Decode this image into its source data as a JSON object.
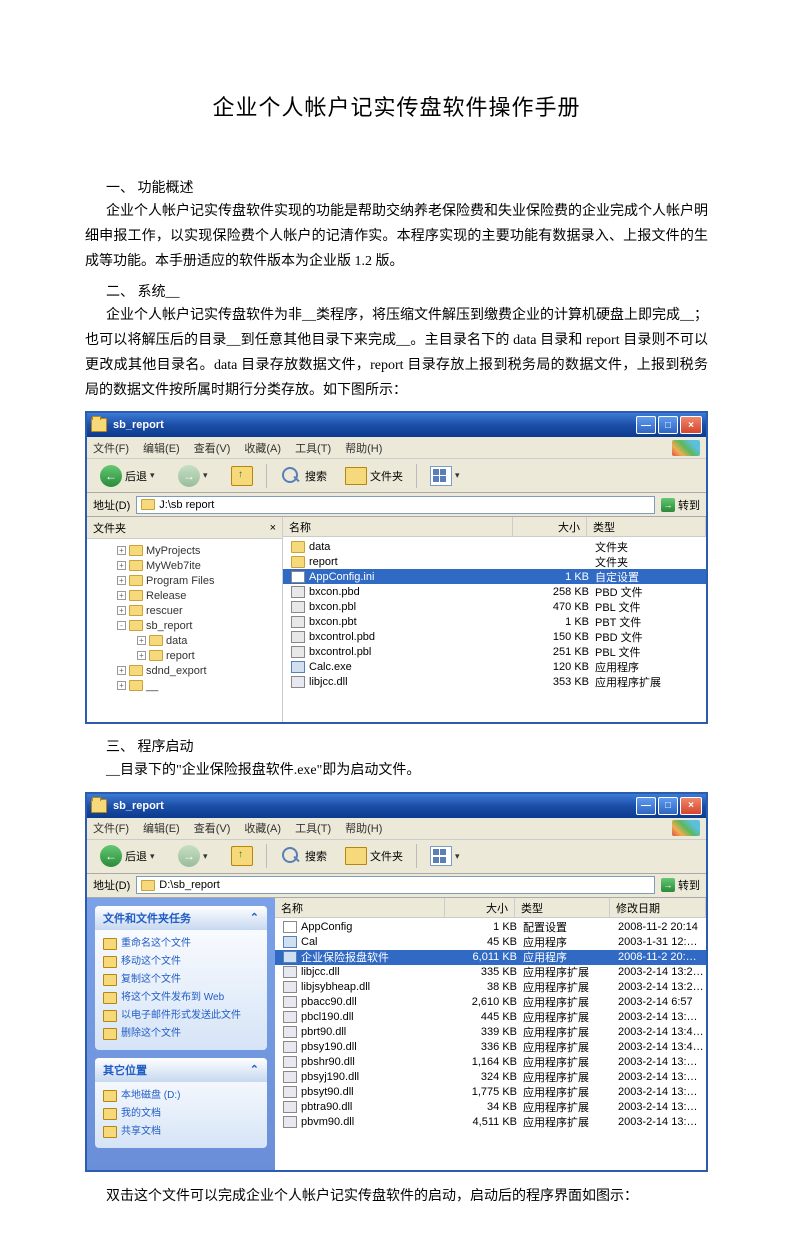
{
  "title": "企业个人帐户记实传盘软件操作手册",
  "s1": {
    "h": "一、 功能概述",
    "p": "企业个人帐户记实传盘软件实现的功能是帮助交纳养老保险费和失业保险费的企业完成个人帐户明细申报工作，以实现保险费个人帐户的记清作实。本程序实现的主要功能有数据录入、上报文件的生成等功能。本手册适应的软件版本为企业版 1.2 版。"
  },
  "s2": {
    "h": "二、 系统__",
    "p": "企业个人帐户记实传盘软件为非__类程序，将压缩文件解压到缴费企业的计算机硬盘上即完成__；也可以将解压后的目录__到任意其他目录下来完成__。主目录名下的 data 目录和 report 目录则不可以更改成其他目录名。data 目录存放数据文件，report 目录存放上报到税务局的数据文件，上报到税务局的数据文件按所属时期行分类存放。如下图所示："
  },
  "s3": {
    "h": "三、 程序启动",
    "p": "__目录下的\"企业保险报盘软件.exe\"即为启动文件。"
  },
  "final": "双击这个文件可以完成企业个人帐户记实传盘软件的启动，启动后的程序界面如图示：",
  "win": {
    "title": "sb_report",
    "menu": [
      "文件(F)",
      "编辑(E)",
      "查看(V)",
      "收藏(A)",
      "工具(T)",
      "帮助(H)"
    ],
    "back": "后退",
    "search": "搜索",
    "folders": "文件夹",
    "addr_label": "地址(D)",
    "addr1": "J:\\sb report",
    "addr2": "D:\\sb_report",
    "go": "转到",
    "left_hdr": "文件夹",
    "right_x": "×",
    "tree": [
      "MyProjects",
      "MyWeb7ite",
      "Program Files",
      "Release",
      "rescuer",
      "sb_report",
      "data",
      "report",
      "sdnd_export",
      "__"
    ],
    "cols1": {
      "name": "名称",
      "size": "大小",
      "type": "类型"
    },
    "list1": [
      {
        "n": "data",
        "s": "",
        "t": "文件夹",
        "k": "fld"
      },
      {
        "n": "report",
        "s": "",
        "t": "文件夹",
        "k": "fld"
      },
      {
        "n": "AppConfig.ini",
        "s": "1 KB",
        "t": "自定设置",
        "k": "ini",
        "sel": true
      },
      {
        "n": "bxcon.pbd",
        "s": "258 KB",
        "t": "PBD 文件",
        "k": "pbd"
      },
      {
        "n": "bxcon.pbl",
        "s": "470 KB",
        "t": "PBL 文件",
        "k": "pbd"
      },
      {
        "n": "bxcon.pbt",
        "s": "1 KB",
        "t": "PBT 文件",
        "k": "pbd"
      },
      {
        "n": "bxcontrol.pbd",
        "s": "150 KB",
        "t": "PBD 文件",
        "k": "pbd"
      },
      {
        "n": "bxcontrol.pbl",
        "s": "251 KB",
        "t": "PBL 文件",
        "k": "pbd"
      },
      {
        "n": "Calc.exe",
        "s": "120 KB",
        "t": "应用程序",
        "k": "exe"
      },
      {
        "n": "libjcc.dll",
        "s": "353 KB",
        "t": "应用程序扩展",
        "k": "dll"
      }
    ],
    "task_hdr1": "文件和文件夹任务",
    "tasks1": [
      "重命名这个文件",
      "移动这个文件",
      "复制这个文件",
      "将这个文件发布到 Web",
      "以电子邮件形式发送此文件",
      "删除这个文件"
    ],
    "task_hdr2": "其它位置",
    "tasks2": [
      "本地磁盘 (D:)",
      "我的文档",
      "共享文档"
    ],
    "cols2": {
      "name": "名称",
      "size": "大小",
      "type": "类型",
      "date": "修改日期"
    },
    "list2": [
      {
        "n": "AppConfig",
        "s": "1 KB",
        "t": "配置设置",
        "d": "2008-11-2 20:14",
        "k": "ini"
      },
      {
        "n": "Cal",
        "s": "45 KB",
        "t": "应用程序",
        "d": "2003-1-31 12:…",
        "k": "exe"
      },
      {
        "n": "企业保险报盘软件",
        "s": "6,011 KB",
        "t": "应用程序",
        "d": "2008-11-2 20:…",
        "k": "exe",
        "sel": true
      },
      {
        "n": "libjcc.dll",
        "s": "335 KB",
        "t": "应用程序扩展",
        "d": "2003-2-14 13:2…",
        "k": "dll"
      },
      {
        "n": "libjsybheap.dll",
        "s": "38 KB",
        "t": "应用程序扩展",
        "d": "2003-2-14 13:2…",
        "k": "dll"
      },
      {
        "n": "pbacc90.dll",
        "s": "2,610 KB",
        "t": "应用程序扩展",
        "d": "2003-2-14 6:57",
        "k": "dll"
      },
      {
        "n": "pbcl190.dll",
        "s": "445 KB",
        "t": "应用程序扩展",
        "d": "2003-2-14 13:…",
        "k": "dll"
      },
      {
        "n": "pbrt90.dll",
        "s": "339 KB",
        "t": "应用程序扩展",
        "d": "2003-2-14 13:4…",
        "k": "dll"
      },
      {
        "n": "pbsy190.dll",
        "s": "336 KB",
        "t": "应用程序扩展",
        "d": "2003-2-14 13:4…",
        "k": "dll"
      },
      {
        "n": "pbshr90.dll",
        "s": "1,164 KB",
        "t": "应用程序扩展",
        "d": "2003-2-14 13:…",
        "k": "dll"
      },
      {
        "n": "pbsyj190.dll",
        "s": "324 KB",
        "t": "应用程序扩展",
        "d": "2003-2-14 13:…",
        "k": "dll"
      },
      {
        "n": "pbsyt90.dll",
        "s": "1,775 KB",
        "t": "应用程序扩展",
        "d": "2003-2-14 13:…",
        "k": "dll"
      },
      {
        "n": "pbtra90.dll",
        "s": "34 KB",
        "t": "应用程序扩展",
        "d": "2003-2-14 13:…",
        "k": "dll"
      },
      {
        "n": "pbvm90.dll",
        "s": "4,511 KB",
        "t": "应用程序扩展",
        "d": "2003-2-14 13:…",
        "k": "dll"
      }
    ]
  }
}
